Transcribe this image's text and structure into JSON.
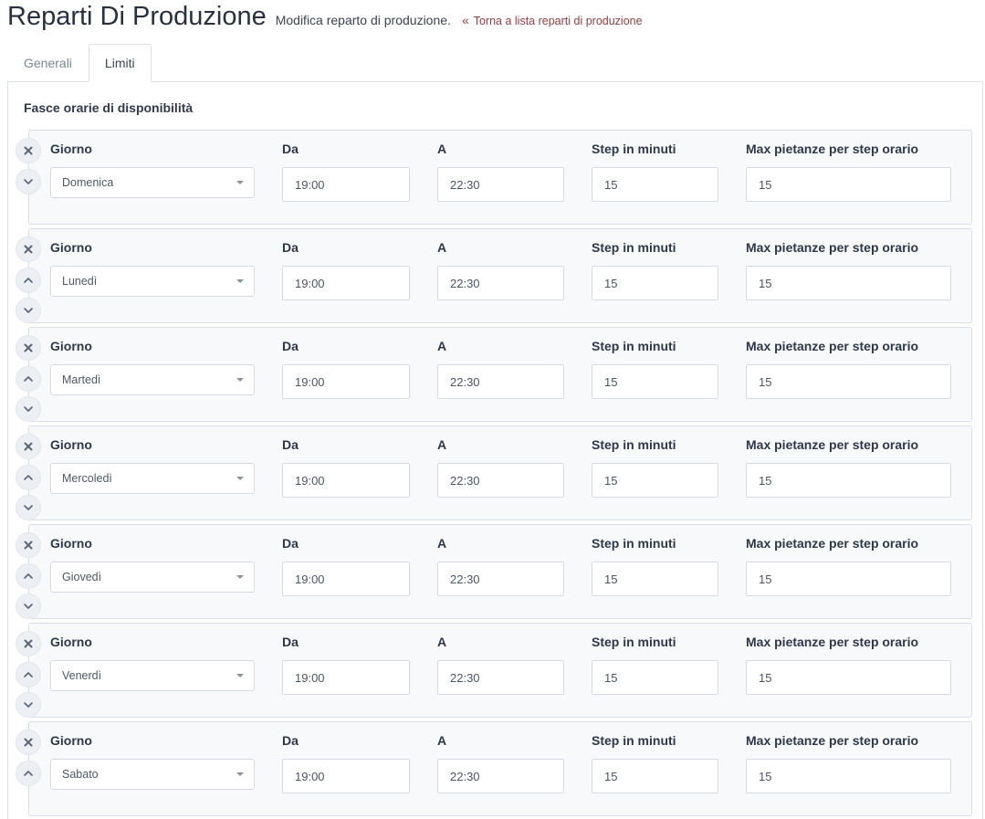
{
  "header": {
    "title": "Reparti Di Produzione",
    "subtitle": "Modifica reparto di produzione.",
    "back_link": "Torna a lista reparti di produzione",
    "back_chevron": "«"
  },
  "tabs": [
    {
      "label": "Generali",
      "active": false
    },
    {
      "label": "Limiti",
      "active": true
    }
  ],
  "section": {
    "title": "Fasce orarie di disponibilità"
  },
  "labels": {
    "giorno": "Giorno",
    "da": "Da",
    "a": "A",
    "step": "Step in minuti",
    "max": "Max pietanze per step orario"
  },
  "icons": {
    "remove": "close-icon",
    "move_up": "chevron-up-icon",
    "move_down": "chevron-down-icon",
    "select": "caret-down-icon"
  },
  "colors": {
    "link": "#a33a3e",
    "row_bg": "#f8f9fb",
    "border": "#d8dee6"
  },
  "rows": [
    {
      "giorno": "Domenica",
      "da": "19:00",
      "a": "22:30",
      "step": "15",
      "max": "15"
    },
    {
      "giorno": "Lunedì",
      "da": "19:00",
      "a": "22:30",
      "step": "15",
      "max": "15"
    },
    {
      "giorno": "Martedì",
      "da": "19:00",
      "a": "22:30",
      "step": "15",
      "max": "15"
    },
    {
      "giorno": "Mercoledì",
      "da": "19:00",
      "a": "22:30",
      "step": "15",
      "max": "15"
    },
    {
      "giorno": "Giovedì",
      "da": "19:00",
      "a": "22:30",
      "step": "15",
      "max": "15"
    },
    {
      "giorno": "Venerdì",
      "da": "19:00",
      "a": "22:30",
      "step": "15",
      "max": "15"
    },
    {
      "giorno": "Sabato",
      "da": "19:00",
      "a": "22:30",
      "step": "15",
      "max": "15"
    }
  ]
}
